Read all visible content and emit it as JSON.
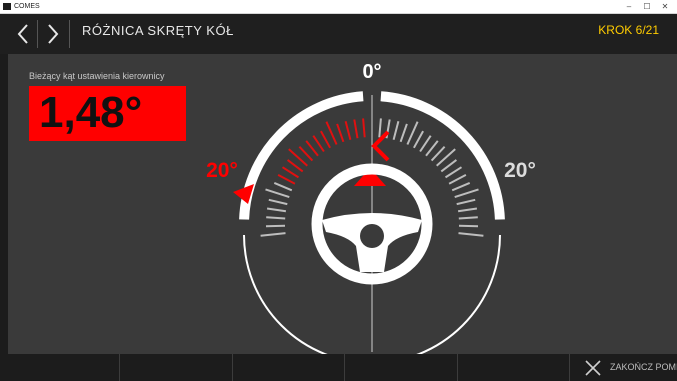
{
  "window": {
    "title": "COMES",
    "minimize_glyph": "–",
    "maximize_glyph": "☐",
    "close_glyph": "✕"
  },
  "header": {
    "back_icon": "chevron-left-icon",
    "forward_icon": "chevron-right-icon",
    "title": "RÓŻNICA SKRĘTY KÓŁ",
    "step": "KROK 6/21",
    "progress_segments_total": 21,
    "progress_segments_done": 5,
    "accent_color": "#ffcc00"
  },
  "reading": {
    "label": "Bieżący kąt ustawienia kierownicy",
    "value": "1,48°",
    "alert_color": "#ff0000"
  },
  "gauge": {
    "center_label": "0°",
    "left_label": "20°",
    "right_label": "20°",
    "current_angle_deg": 1.48,
    "scale_max_deg": 20
  },
  "bottom": {
    "finish_label": "ZAKOŃCZ POMIAR",
    "finish_icon": "close-icon"
  }
}
